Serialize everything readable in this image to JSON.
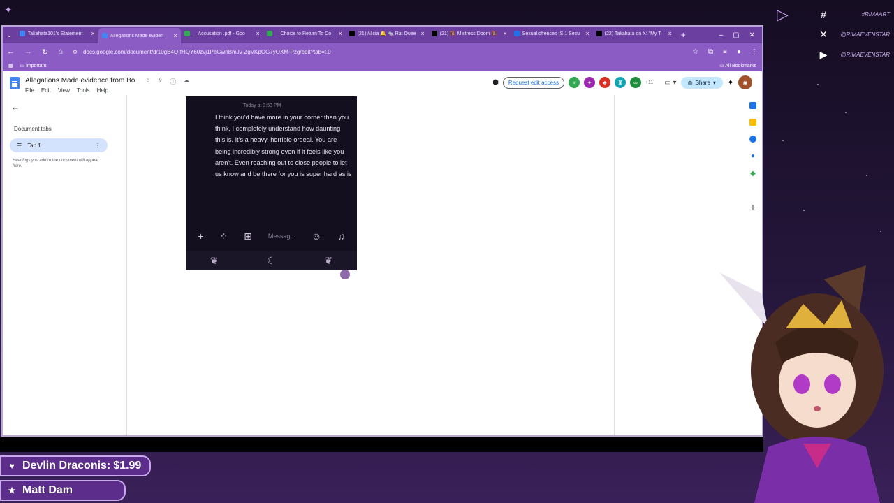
{
  "browser": {
    "tabs": [
      {
        "title": "Takahata101's Statement",
        "icon": "docs",
        "color": "#4285f4"
      },
      {
        "title": "Allegations Made eviden",
        "icon": "docs",
        "color": "#4285f4",
        "active": true
      },
      {
        "title": "__Accusation .pdf - Goo",
        "icon": "drive",
        "color": "#34a853"
      },
      {
        "title": "__Choice to Return To Co",
        "icon": "drive",
        "color": "#34a853"
      },
      {
        "title": "(21) Alicia 🔔 🐀 Rat Quee",
        "icon": "x",
        "color": "#000000"
      },
      {
        "title": "(21) 🔞 Mistress Doom 🔞",
        "icon": "x",
        "color": "#000000"
      },
      {
        "title": "Sexual offences (S.1 Sexu",
        "icon": "site",
        "color": "#1a73e8"
      },
      {
        "title": "(22) Takahata on X: \"My T",
        "icon": "x",
        "color": "#000000"
      }
    ],
    "url": "docs.google.com/document/d/10gB4Q-fHQY60zvj1PeGwhBmJv-ZgVKpOG7yOXM-Pzg/edit?tab=t.0",
    "bookmark": "important",
    "all_bookmarks": "All Bookmarks"
  },
  "docs": {
    "title": "Allegations Made evidence from Bo",
    "menus": [
      "File",
      "Edit",
      "View",
      "Tools",
      "Help"
    ],
    "request_edit": "Request edit access",
    "share": "Share",
    "extra_users": "+11"
  },
  "sidebar": {
    "heading": "Document tabs",
    "tab1": "Tab 1",
    "hint": "Headings you add to the document will appear here."
  },
  "screenshot": {
    "time": "Today at 3:53 PM",
    "message": "I think you'd have more in your corner than you think, I completely understand how daunting this is. It's a heavy, horrible ordeal. You are being incredibly strong even if it feels like you aren't. Even reaching out to close people to let us know and be there for you is super hard as is",
    "input_placeholder": "Messag..."
  },
  "overlay": {
    "socials": [
      "#RIMAART",
      "@RIMAEVENSTAR",
      "@RIMAEVENSTAR"
    ],
    "donations": [
      {
        "name": "Devlin Draconis:",
        "amount": "$1.99",
        "icon": "heart-icon"
      },
      {
        "name": "Matt Dam",
        "icon": "star-icon"
      }
    ]
  }
}
